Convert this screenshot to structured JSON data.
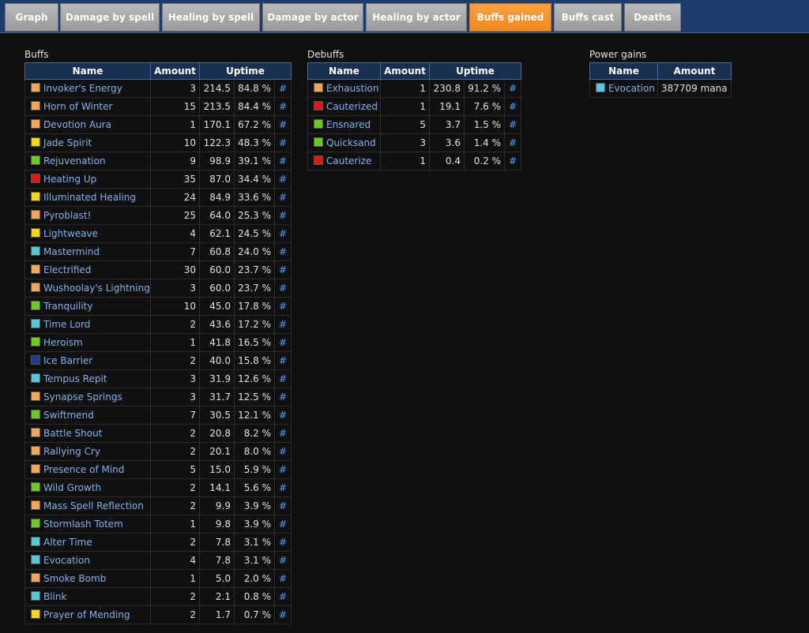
{
  "tabs": [
    {
      "label": "Graph"
    },
    {
      "label": "Damage by spell"
    },
    {
      "label": "Healing by spell"
    },
    {
      "label": "Damage by actor"
    },
    {
      "label": "Healing by actor"
    },
    {
      "label": "Buffs gained"
    },
    {
      "label": "Buffs cast"
    },
    {
      "label": "Deaths"
    }
  ],
  "active_tab": "Buffs gained",
  "colors": {
    "orange": "#f6a552",
    "red": "#e01818",
    "yellow": "#f6d808",
    "green": "#6ccb1b",
    "cyan": "#52c9dc",
    "blue": "#1c3c8c",
    "link": "#7fb2ec",
    "hash": "#4aa0ff",
    "active_tab": "#f59028"
  },
  "buffs": {
    "title": "Buffs",
    "headers": {
      "name": "Name",
      "amount": "Amount",
      "uptime": "Uptime"
    },
    "rows": [
      {
        "color": "orange",
        "name": "Invoker's Energy",
        "amount": "3",
        "time": "214.5",
        "pct": "84.8 %",
        "link": "#"
      },
      {
        "color": "orange",
        "name": "Horn of Winter",
        "amount": "15",
        "time": "213.5",
        "pct": "84.4 %",
        "link": "#"
      },
      {
        "color": "orange",
        "name": "Devotion Aura",
        "amount": "1",
        "time": "170.1",
        "pct": "67.2 %",
        "link": "#"
      },
      {
        "color": "yellow",
        "name": "Jade Spirit",
        "amount": "10",
        "time": "122.3",
        "pct": "48.3 %",
        "link": "#"
      },
      {
        "color": "green",
        "name": "Rejuvenation",
        "amount": "9",
        "time": "98.9",
        "pct": "39.1 %",
        "link": "#"
      },
      {
        "color": "red",
        "name": "Heating Up",
        "amount": "35",
        "time": "87.0",
        "pct": "34.4 %",
        "link": "#"
      },
      {
        "color": "yellow",
        "name": "Illuminated Healing",
        "amount": "24",
        "time": "84.9",
        "pct": "33.6 %",
        "link": "#"
      },
      {
        "color": "orange",
        "name": "Pyroblast!",
        "amount": "25",
        "time": "64.0",
        "pct": "25.3 %",
        "link": "#"
      },
      {
        "color": "yellow",
        "name": "Lightweave",
        "amount": "4",
        "time": "62.1",
        "pct": "24.5 %",
        "link": "#"
      },
      {
        "color": "cyan",
        "name": "Mastermind",
        "amount": "7",
        "time": "60.8",
        "pct": "24.0 %",
        "link": "#"
      },
      {
        "color": "orange",
        "name": "Electrified",
        "amount": "30",
        "time": "60.0",
        "pct": "23.7 %",
        "link": "#"
      },
      {
        "color": "orange",
        "name": "Wushoolay's Lightning",
        "amount": "3",
        "time": "60.0",
        "pct": "23.7 %",
        "link": "#"
      },
      {
        "color": "green",
        "name": "Tranquility",
        "amount": "10",
        "time": "45.0",
        "pct": "17.8 %",
        "link": "#"
      },
      {
        "color": "cyan",
        "name": "Time Lord",
        "amount": "2",
        "time": "43.6",
        "pct": "17.2 %",
        "link": "#"
      },
      {
        "color": "green",
        "name": "Heroism",
        "amount": "1",
        "time": "41.8",
        "pct": "16.5 %",
        "link": "#"
      },
      {
        "color": "blue",
        "name": "Ice Barrier",
        "amount": "2",
        "time": "40.0",
        "pct": "15.8 %",
        "link": "#"
      },
      {
        "color": "cyan",
        "name": "Tempus Repit",
        "amount": "3",
        "time": "31.9",
        "pct": "12.6 %",
        "link": "#"
      },
      {
        "color": "orange",
        "name": "Synapse Springs",
        "amount": "3",
        "time": "31.7",
        "pct": "12.5 %",
        "link": "#"
      },
      {
        "color": "green",
        "name": "Swiftmend",
        "amount": "7",
        "time": "30.5",
        "pct": "12.1 %",
        "link": "#"
      },
      {
        "color": "orange",
        "name": "Battle Shout",
        "amount": "2",
        "time": "20.8",
        "pct": "8.2 %",
        "link": "#"
      },
      {
        "color": "orange",
        "name": "Rallying Cry",
        "amount": "2",
        "time": "20.1",
        "pct": "8.0 %",
        "link": "#"
      },
      {
        "color": "orange",
        "name": "Presence of Mind",
        "amount": "5",
        "time": "15.0",
        "pct": "5.9 %",
        "link": "#"
      },
      {
        "color": "green",
        "name": "Wild Growth",
        "amount": "2",
        "time": "14.1",
        "pct": "5.6 %",
        "link": "#"
      },
      {
        "color": "orange",
        "name": "Mass Spell Reflection",
        "amount": "2",
        "time": "9.9",
        "pct": "3.9 %",
        "link": "#"
      },
      {
        "color": "green",
        "name": "Stormlash Totem",
        "amount": "1",
        "time": "9.8",
        "pct": "3.9 %",
        "link": "#"
      },
      {
        "color": "cyan",
        "name": "Alter Time",
        "amount": "2",
        "time": "7.8",
        "pct": "3.1 %",
        "link": "#"
      },
      {
        "color": "cyan",
        "name": "Evocation",
        "amount": "4",
        "time": "7.8",
        "pct": "3.1 %",
        "link": "#"
      },
      {
        "color": "orange",
        "name": "Smoke Bomb",
        "amount": "1",
        "time": "5.0",
        "pct": "2.0 %",
        "link": "#"
      },
      {
        "color": "cyan",
        "name": "Blink",
        "amount": "2",
        "time": "2.1",
        "pct": "0.8 %",
        "link": "#"
      },
      {
        "color": "yellow",
        "name": "Prayer of Mending",
        "amount": "2",
        "time": "1.7",
        "pct": "0.7 %",
        "link": "#"
      }
    ]
  },
  "debuffs": {
    "title": "Debuffs",
    "headers": {
      "name": "Name",
      "amount": "Amount",
      "uptime": "Uptime"
    },
    "rows": [
      {
        "color": "orange",
        "name": "Exhaustion",
        "amount": "1",
        "time": "230.8",
        "pct": "91.2 %",
        "link": "#"
      },
      {
        "color": "red",
        "name": "Cauterized",
        "amount": "1",
        "time": "19.1",
        "pct": "7.6 %",
        "link": "#"
      },
      {
        "color": "green",
        "name": "Ensnared",
        "amount": "5",
        "time": "3.7",
        "pct": "1.5 %",
        "link": "#"
      },
      {
        "color": "green",
        "name": "Quicksand",
        "amount": "3",
        "time": "3.6",
        "pct": "1.4 %",
        "link": "#"
      },
      {
        "color": "red",
        "name": "Cauterize",
        "amount": "1",
        "time": "0.4",
        "pct": "0.2 %",
        "link": "#"
      }
    ]
  },
  "power_gains": {
    "title": "Power gains",
    "headers": {
      "name": "Name",
      "amount": "Amount"
    },
    "rows": [
      {
        "color": "cyan",
        "name": "Evocation",
        "amount": "387709 mana"
      }
    ]
  }
}
